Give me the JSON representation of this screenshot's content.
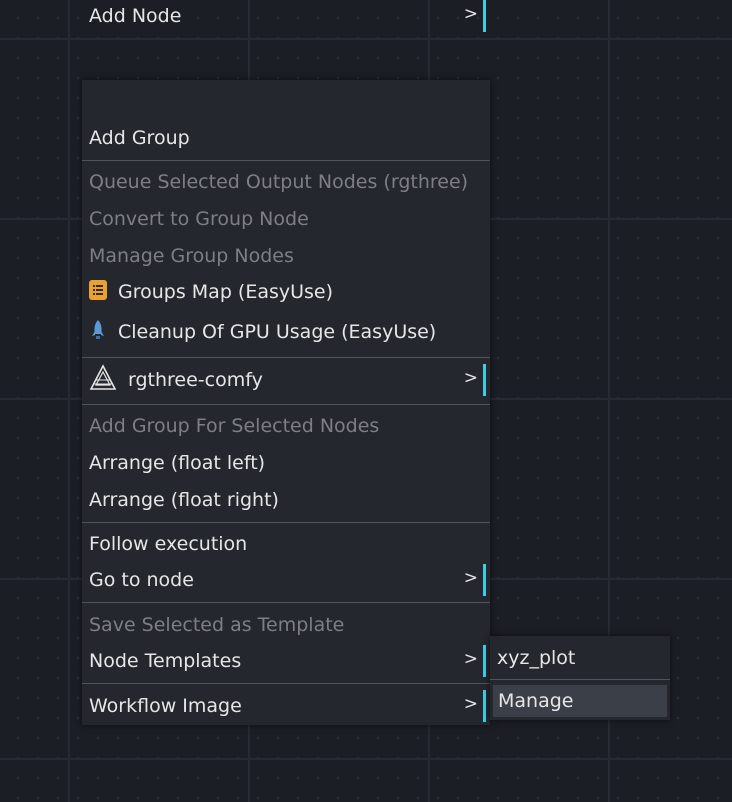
{
  "menu": {
    "items": [
      {
        "label": "Add Node",
        "submenu": true,
        "disabled": false
      },
      {
        "label": "Add Group",
        "submenu": false,
        "disabled": false
      },
      {
        "label": "Queue Selected Output Nodes (rgthree)",
        "submenu": false,
        "disabled": true
      },
      {
        "label": "Convert to Group Node",
        "submenu": false,
        "disabled": true
      },
      {
        "label": "Manage Group Nodes",
        "submenu": false,
        "disabled": true
      },
      {
        "label": "Groups Map (EasyUse)",
        "submenu": false,
        "disabled": false,
        "icon": "groups-map-icon"
      },
      {
        "label": "Cleanup Of GPU Usage (EasyUse)",
        "submenu": false,
        "disabled": false,
        "icon": "rocket-icon"
      },
      {
        "label": "rgthree-comfy",
        "submenu": true,
        "disabled": false,
        "icon": "rgthree-logo-icon"
      },
      {
        "label": "Add Group For Selected Nodes",
        "submenu": false,
        "disabled": true
      },
      {
        "label": "Arrange (float left)",
        "submenu": false,
        "disabled": false
      },
      {
        "label": "Arrange (float right)",
        "submenu": false,
        "disabled": false
      },
      {
        "label": "Follow execution",
        "submenu": false,
        "disabled": false
      },
      {
        "label": "Go to node",
        "submenu": true,
        "disabled": false
      },
      {
        "label": "Save Selected as Template",
        "submenu": false,
        "disabled": true
      },
      {
        "label": "Node Templates",
        "submenu": true,
        "disabled": false
      },
      {
        "label": "Workflow Image",
        "submenu": true,
        "disabled": false
      }
    ],
    "arrow_glyph": ">"
  },
  "submenu": {
    "items": [
      {
        "label": "xyz_plot",
        "hovered": false
      },
      {
        "label": "Manage",
        "hovered": true
      }
    ]
  },
  "colors": {
    "accent": "#3fcde2",
    "menu_bg": "#24272e",
    "text": "#e6e6e6",
    "disabled_text": "#7d7f85",
    "canvas_bg": "#1b1e25"
  }
}
